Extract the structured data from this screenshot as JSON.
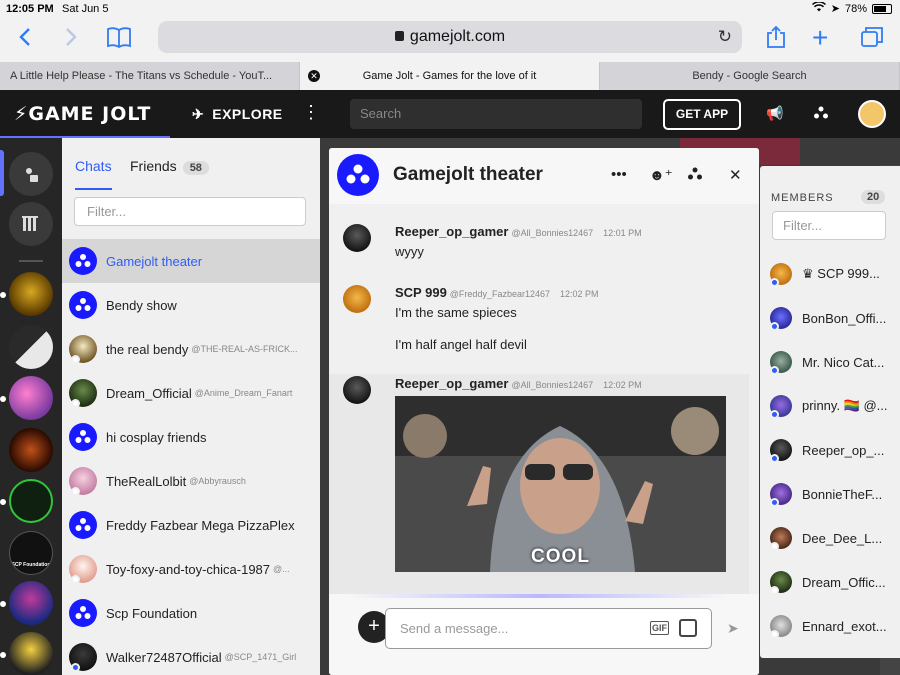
{
  "status_bar": {
    "time": "12:05 PM",
    "date": "Sat Jun 5",
    "battery": "78%"
  },
  "safari": {
    "url": "gamejolt.com"
  },
  "tabs": [
    {
      "title": "A Little Help Please - The Titans vs Schedule - YouT..."
    },
    {
      "title": "Game Jolt - Games for the love of it"
    },
    {
      "title": "Bendy - Google Search"
    }
  ],
  "header": {
    "logo": "GAME JOLT",
    "explore_label": "EXPLORE",
    "search_placeholder": "Search",
    "get_app_label": "GET APP"
  },
  "rail": {
    "items": [
      {
        "label": ""
      },
      {
        "label": ""
      },
      {
        "label": ""
      },
      {
        "label": ""
      },
      {
        "label": ""
      },
      {
        "label": "SCP Foundation"
      },
      {
        "label": ""
      },
      {
        "label": ""
      }
    ]
  },
  "chats_panel": {
    "tab_chats": "Chats",
    "tab_friends": "Friends",
    "friends_count": "58",
    "filter_placeholder": "Filter...",
    "items": [
      {
        "name": "Gamejolt theater",
        "handle": ""
      },
      {
        "name": "Bendy show",
        "handle": ""
      },
      {
        "name": "the real bendy",
        "handle": "@THE-REAL-AS-FRICK..."
      },
      {
        "name": "Dream_Official",
        "handle": "@Anime_Dream_Fanart"
      },
      {
        "name": "hi cosplay friends",
        "handle": ""
      },
      {
        "name": "TheRealLolbit",
        "handle": "@Abbyrausch"
      },
      {
        "name": "Freddy Fazbear Mega PizzaPlex",
        "handle": ""
      },
      {
        "name": "Toy-foxy-and-toy-chica-1987",
        "handle": "@..."
      },
      {
        "name": "Scp Foundation",
        "handle": ""
      },
      {
        "name": "Walker72487Official",
        "handle": "@SCP_1471_Girl"
      }
    ]
  },
  "chat_window": {
    "title": "Gamejolt theater",
    "messages": [
      {
        "user": "Reeper_op_gamer",
        "handle": "@All_Bonnies12467",
        "time": "12:01 PM",
        "lines": [
          "wyyy"
        ]
      },
      {
        "user": "SCP 999",
        "handle": "@Freddy_Fazbear12467",
        "time": "12:02 PM",
        "lines": [
          "I'm the  same spieces",
          "I'm half angel half devil"
        ]
      },
      {
        "user": "Reeper_op_gamer",
        "handle": "@All_Bonnies12467",
        "time": "12:02 PM",
        "gif_caption": "COOL"
      }
    ],
    "input_placeholder": "Send a message...",
    "gif_label": "GIF"
  },
  "members_panel": {
    "title": "MEMBERS",
    "count": "20",
    "filter_placeholder": "Filter...",
    "members": [
      {
        "name": "SCP 999..."
      },
      {
        "name": "BonBon_Offi..."
      },
      {
        "name": "Mr. Nico Cat..."
      },
      {
        "name": "prinny. 🏳️‍🌈 @..."
      },
      {
        "name": "Reeper_op_..."
      },
      {
        "name": "BonnieTheF..."
      },
      {
        "name": "Dee_Dee_L..."
      },
      {
        "name": "Dream_Offic..."
      },
      {
        "name": "Ennard_exot..."
      }
    ]
  },
  "colors": {
    "accent": "#2f5cf6",
    "group_icon": "#1a1aff",
    "header_bg": "#191919"
  }
}
